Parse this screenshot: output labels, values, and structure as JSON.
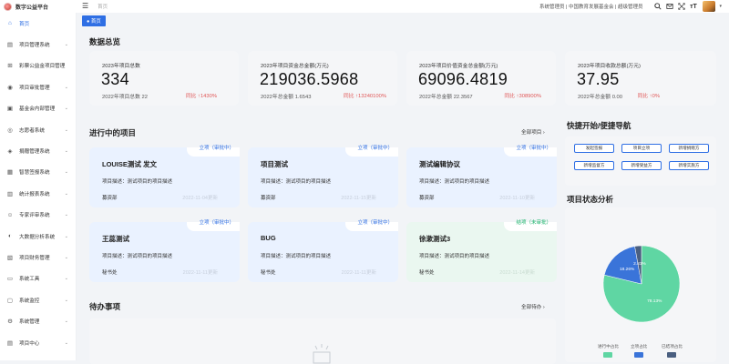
{
  "app": {
    "title": "数字公益平台"
  },
  "header": {
    "breadcrumb": "首页",
    "user": "系统管理员 | 中国教育发展基金会 | 超级管理员"
  },
  "tabs": [
    {
      "label": "首页"
    }
  ],
  "sidebar": {
    "items": [
      {
        "label": "首页",
        "icon": "home-icon"
      },
      {
        "label": "项目管理系统",
        "icon": "file-icon"
      },
      {
        "label": "彩票公益金项目管理",
        "icon": "ticket-icon"
      },
      {
        "label": "项目审批管理",
        "icon": "approve-icon"
      },
      {
        "label": "基金会内部管理",
        "icon": "building-icon"
      },
      {
        "label": "志愿者系统",
        "icon": "volunteer-icon"
      },
      {
        "label": "捐赠管理系统",
        "icon": "donate-icon"
      },
      {
        "label": "智慧签报系统",
        "icon": "sign-icon"
      },
      {
        "label": "统计报表系统",
        "icon": "chart-icon"
      },
      {
        "label": "专家评审系统",
        "icon": "expert-icon"
      },
      {
        "label": "大数据分析系统",
        "icon": "data-icon"
      },
      {
        "label": "项目财务管理",
        "icon": "finance-icon"
      },
      {
        "label": "系统工具",
        "icon": "tool-icon"
      },
      {
        "label": "系统监控",
        "icon": "monitor-icon"
      },
      {
        "label": "系统管理",
        "icon": "settings-icon"
      },
      {
        "label": "项目中心",
        "icon": "center-icon"
      }
    ]
  },
  "overview": {
    "title": "数据总览",
    "cards": [
      {
        "label": "2023年项目总数",
        "value": "334",
        "sub": "2022年项目总数 22",
        "change_prefix": "同比",
        "change": "↑1430%"
      },
      {
        "label": "2023年项目资金总金额(万元)",
        "value": "219036.5968",
        "sub": "2022年总金额 1.6543",
        "change_prefix": "同比",
        "change": "↑13240100%"
      },
      {
        "label": "2023年项目价值资金总金额(万元)",
        "value": "69096.4819",
        "sub": "2022年总金额 22.3567",
        "change_prefix": "同比",
        "change": "↑308900%"
      },
      {
        "label": "2023年项目收款总额(万元)",
        "value": "37.95",
        "sub": "2022年总金额 0.00",
        "change_prefix": "同比",
        "change": "↑0%"
      }
    ]
  },
  "projects": {
    "title": "进行中的项目",
    "all_label": "全部项目 ›",
    "items": [
      {
        "name": "LOUISE测试 发文",
        "status": "立项（审批中）",
        "desc": "项目描述：测试项目的项目描述",
        "dept": "募资部",
        "date": "2022-11-04更新",
        "style": "blue"
      },
      {
        "name": "项目测试",
        "status": "立项（审批中）",
        "desc": "项目描述：测试项目的项目描述",
        "dept": "募资部",
        "date": "2022-11-15更新",
        "style": "blue"
      },
      {
        "name": "测试编辑协议",
        "status": "立项（审批中）",
        "desc": "项目描述：测试项目的项目描述",
        "dept": "募资部",
        "date": "2022-11-10更新",
        "style": "blue"
      },
      {
        "name": "王蕊测试",
        "status": "立项（审批中）",
        "desc": "项目描述：测试项目的项目描述",
        "dept": "秘书处",
        "date": "2022-11-11更新",
        "style": "blue"
      },
      {
        "name": "BUG",
        "status": "立项（审批中）",
        "desc": "项目描述：测试项目的项目描述",
        "dept": "秘书处",
        "date": "2022-11-11更新",
        "style": "blue"
      },
      {
        "name": "徐漱测试3",
        "status": "结项（未审批）",
        "desc": "项目描述：测试项目的项目描述",
        "dept": "秘书处",
        "date": "2022-11-14更新",
        "style": "green"
      }
    ]
  },
  "todo": {
    "title": "待办事项",
    "all_label": "全部待办 ›"
  },
  "quick": {
    "title": "快捷开始/便捷导航",
    "buttons": [
      "发起签报",
      "项目立项",
      "新增捐赠方",
      "新增监督方",
      "新增受益方",
      "新增实施方"
    ]
  },
  "status_chart": {
    "title": "项目状态分析",
    "colors": {
      "in_progress": "#5fd6a3",
      "approved": "#3a74d9",
      "closed": "#4a5f80"
    }
  },
  "chart_data": {
    "type": "pie",
    "title": "项目状态分析",
    "series": [
      {
        "name": "进行中占比",
        "value": 78.13,
        "label": "78.13%",
        "color": "#5fd6a3"
      },
      {
        "name": "立项占比",
        "value": 18.26,
        "label": "18.26%",
        "color": "#3a74d9"
      },
      {
        "name": "已结项占比",
        "value": 2.81,
        "label": "2.81%",
        "color": "#4a5f80"
      }
    ],
    "legend_position": "bottom"
  }
}
